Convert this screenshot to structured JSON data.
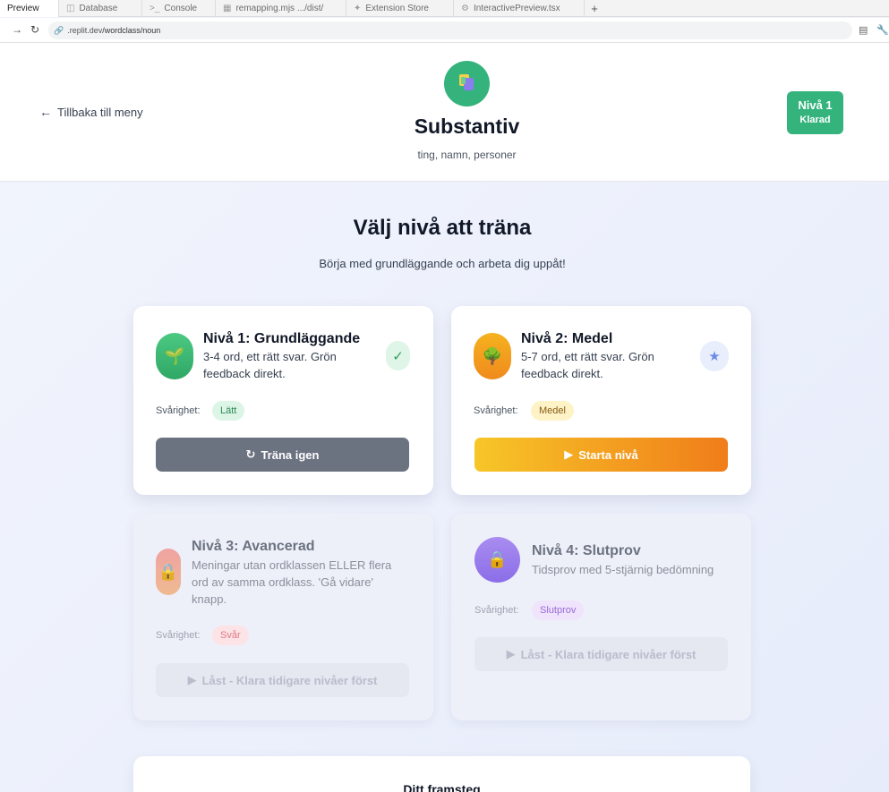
{
  "browser": {
    "tabs": [
      {
        "label": "Preview",
        "icon": ""
      },
      {
        "label": "Database",
        "icon": "database-icon"
      },
      {
        "label": "Console",
        "icon": "terminal-icon"
      },
      {
        "label": "remapping.mjs .../dist/",
        "icon": "file-icon"
      },
      {
        "label": "Extension Store",
        "icon": "puzzle-icon"
      },
      {
        "label": "InteractivePreview.tsx",
        "icon": "gear-icon"
      }
    ],
    "new_tab": "+",
    "url_host": ".replit.dev",
    "url_path": "/wordclass/noun"
  },
  "header": {
    "back_label": "Tillbaka till meny",
    "title": "Substantiv",
    "subtitle": "ting, namn, personer",
    "badge_level": "Nivå 1",
    "badge_status": "Klarad",
    "accent": "#34b37d"
  },
  "main": {
    "heading": "Välj nivå att träna",
    "lead": "Börja med grundläggande och arbeta dig uppåt!",
    "difficulty_label": "Svårighet:",
    "levels": [
      {
        "title": "Nivå 1: Grundläggande",
        "description": "3-4 ord, ett rätt svar. Grön feedback direkt.",
        "difficulty": "Lätt",
        "button": "Träna igen",
        "icon": "sprout-icon",
        "status": "completed",
        "status_icon": "checkmark-icon"
      },
      {
        "title": "Nivå 2: Medel",
        "description": "5-7 ord, ett rätt svar. Grön feedback direkt.",
        "difficulty": "Medel",
        "button": "Starta nivå",
        "icon": "tree-icon",
        "status": "available",
        "status_icon": "star-icon"
      },
      {
        "title": "Nivå 3: Avancerad",
        "description": "Meningar utan ordklassen ELLER flera ord av samma ordklass. 'Gå vidare' knapp.",
        "difficulty": "Svår",
        "button": "Låst - Klara tidigare nivåer först",
        "icon": "lock-icon",
        "status": "locked"
      },
      {
        "title": "Nivå 4: Slutprov",
        "description": "Tidsprov med 5-stjärnig bedömning",
        "difficulty": "Slutprov",
        "button": "Låst - Klara tidigare nivåer först",
        "icon": "lock-icon",
        "status": "locked"
      }
    ],
    "progress_title": "Ditt framsteg"
  }
}
